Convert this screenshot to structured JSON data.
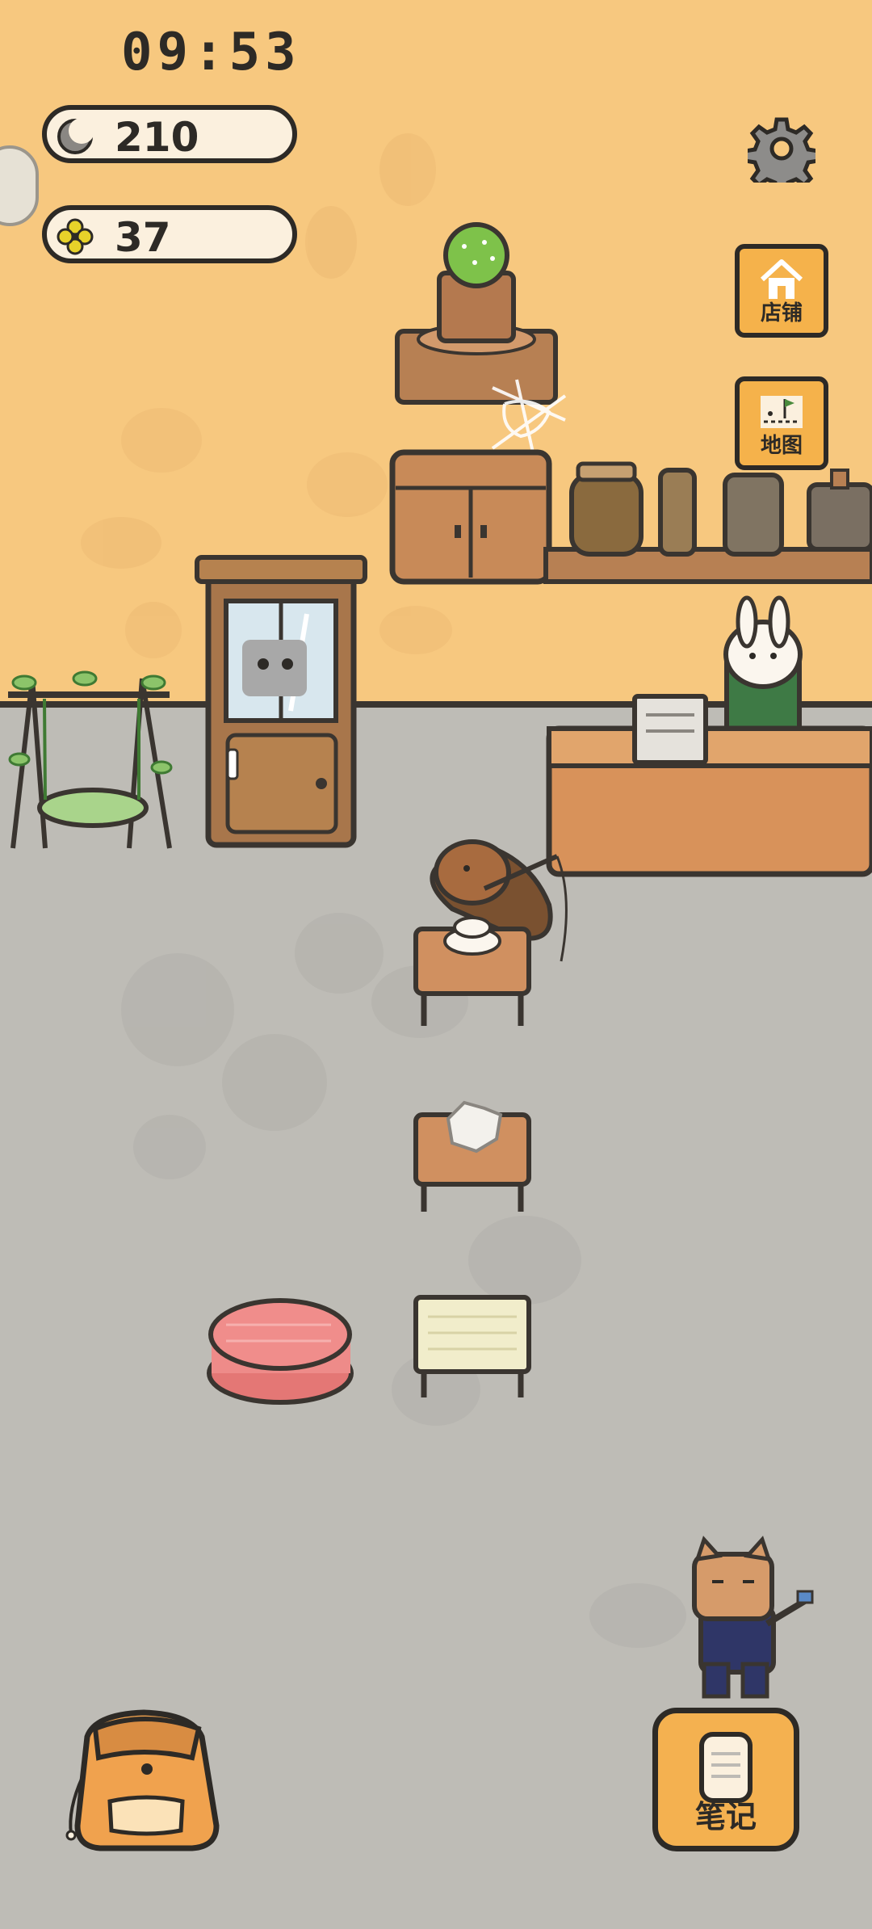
{
  "status": {
    "time": "09:53"
  },
  "currencies": [
    {
      "icon": "moon-icon",
      "value": "210"
    },
    {
      "icon": "clover-icon",
      "value": "37"
    }
  ],
  "menu": {
    "settings_icon": "gear-icon",
    "shop_label": "店铺",
    "map_label": "地图",
    "notes_label": "笔记"
  },
  "colors": {
    "wall": "#f7c87f",
    "floor": "#bebcb6",
    "button": "#f5b24b",
    "outline": "#2d2a26"
  }
}
